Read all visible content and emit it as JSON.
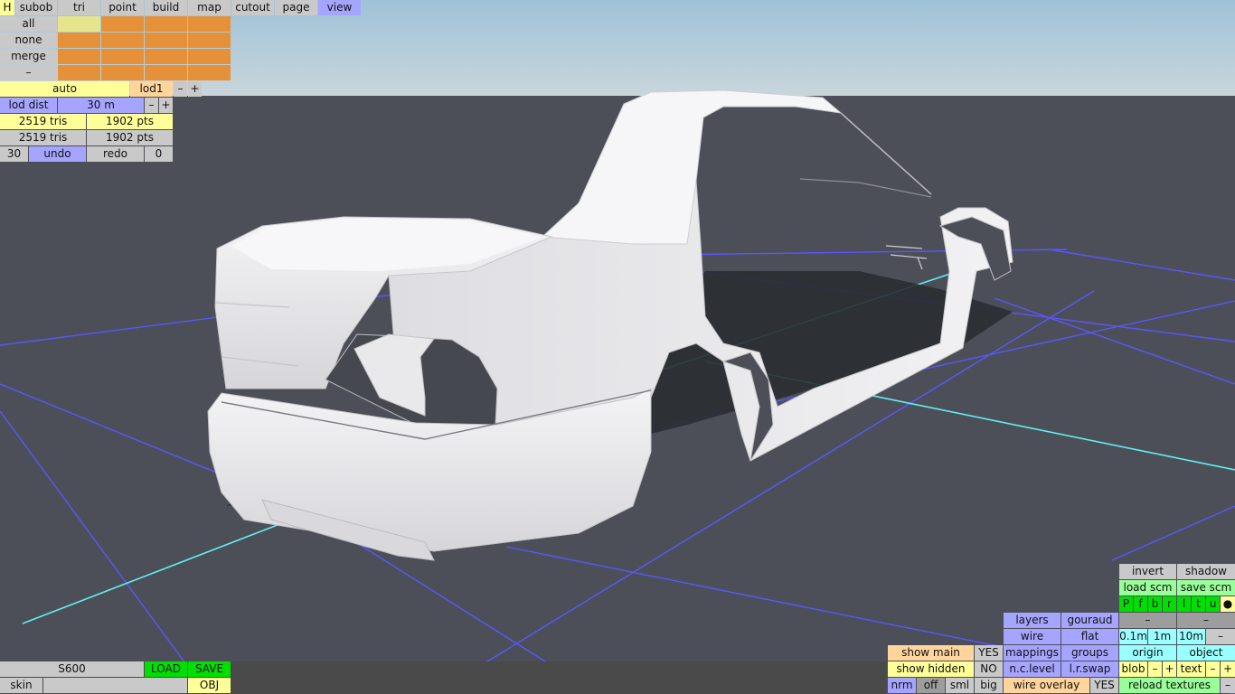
{
  "colors": {
    "sky_top": "#9fc2d8",
    "sky_bottom": "#c7d4da",
    "floor": "#4d4f58",
    "grid": "#5a55ff",
    "axis": "#5ff0f0",
    "body": "#ececef",
    "shadow": "#2b2d33"
  },
  "menu": {
    "h": "H",
    "subob": "subob",
    "tri": "tri",
    "point": "point",
    "build": "build",
    "map": "map",
    "cutout": "cutout",
    "page": "page",
    "view": "view"
  },
  "selection": {
    "all": "all",
    "none": "none",
    "merge": "merge",
    "minus": "–"
  },
  "lod": {
    "auto": "auto",
    "lod1": "lod1",
    "minus": "–",
    "plus": "+",
    "dist_label": "lod dist",
    "dist_value": "30 m",
    "dist_minus": "–",
    "dist_plus": "+"
  },
  "stats": {
    "tris_1": "2519 tris",
    "pts_1": "1902 pts",
    "tris_2": "2519 tris",
    "pts_2": "1902 pts"
  },
  "history": {
    "count": "30",
    "undo": "undo",
    "redo": "redo",
    "redo_count": "0"
  },
  "model": {
    "name": "S600",
    "load": "LOAD",
    "save": "SAVE",
    "skin": "skin",
    "obj": "OBJ"
  },
  "view_panel": {
    "invert": "invert",
    "shadow": "shadow",
    "load_scm": "load scm",
    "save_scm": "save scm",
    "toggles": [
      "P",
      "f",
      "b",
      "r",
      "l",
      "t",
      "u",
      "●"
    ],
    "minus_a": "–",
    "minus_b": "–",
    "layers": "layers",
    "gouraud": "gouraud",
    "wire": "wire",
    "flat": "flat",
    "step_01": "0.1m",
    "step_1": "1m",
    "step_10": "10m",
    "step_minus": "–",
    "show_main": "show main",
    "show_main_value": "YES",
    "mappings": "mappings",
    "groups": "groups",
    "origin": "origin",
    "object": "object",
    "show_hidden": "show hidden",
    "show_hidden_value": "NO",
    "nc_level": "n.c.level",
    "lr_swap": "l.r.swap",
    "blob": "blob",
    "blob_minus": "–",
    "blob_plus": "+",
    "text": "text",
    "text_minus": "–",
    "text_plus": "+",
    "nrm": "nrm",
    "off": "off",
    "sml": "sml",
    "big": "big",
    "wire_overlay": "wire overlay",
    "wire_overlay_value": "YES",
    "reload_textures": "reload textures",
    "reload_minus": "–"
  }
}
